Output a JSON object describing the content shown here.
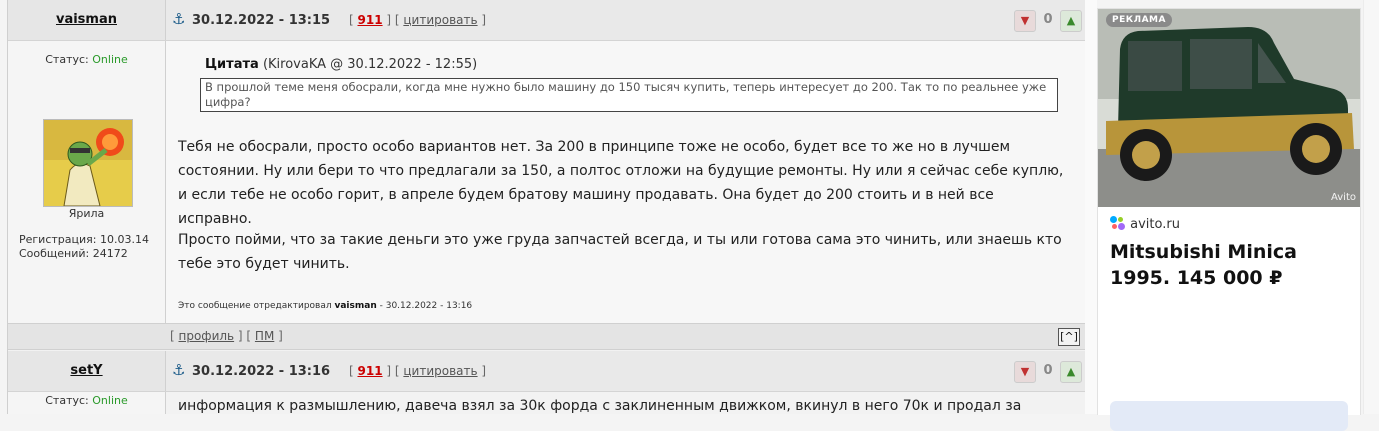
{
  "posts": [
    {
      "username": "vaisman",
      "date": "30.12.2022 - 13:15",
      "post_number": "911",
      "quote_label": "цитировать",
      "rating": "0",
      "status_label": "Статус:",
      "status_value": "Online",
      "avatar_caption": "Ярила",
      "registration": "Регистрация: 10.03.14",
      "messages": "Сообщений: 24172",
      "quote_header_bold": "Цитата",
      "quote_header_rest": "(KirovaKA @ 30.12.2022 - 12:55)",
      "quote_text": "В прошлой теме меня обосрали, когда мне нужно было машину до 150 тысяч купить, теперь интересует до 200. Так то по реальнее уже цифра?",
      "paragraph1": "Тебя не обосрали, просто особо вариантов нет. За 200 в принципе тоже не особо, будет все то же но в лучшем состоянии. Ну или бери то что предлагали за 150, а полтос отложи на будущие ремонты. Ну или я сейчас себе куплю, и если тебе не особо горит, в апреле будем братову машину продавать. Она будет до 200 стоить и в ней все исправно.",
      "paragraph2": "Просто пойми, что за такие деньги это уже груда запчастей всегда, и ты или готова сама это чинить, или знаешь кто тебе это будет чинить.",
      "edited_prefix": "Это сообщение отредактировал",
      "edited_user": "vaisman",
      "edited_time": "- 30.12.2022 - 13:16",
      "profile_link": "профиль",
      "pm_link": "ПМ",
      "up_label": "[^]"
    },
    {
      "username": "setY",
      "date": "30.12.2022 - 13:16",
      "post_number": "911",
      "quote_label": "цитировать",
      "rating": "0",
      "status_label": "Статус:",
      "status_value": "Online",
      "paragraph1": "информация к размышлению, давеча взял за 30к форда с заклиненным движком, вкинул в него 70к и продал за"
    }
  ],
  "ad": {
    "badge": "РЕКЛАМА",
    "watermark": "Avito",
    "source": "avito.ru",
    "title": "Mitsubishi Minica 1995. 145 000 ₽"
  },
  "colors": {
    "online": "#2a9a2a",
    "post_number": "#cc0000"
  },
  "icons": [
    "anchor-icon",
    "thumb-down-icon",
    "thumb-up-icon",
    "avito-logo-icon"
  ]
}
